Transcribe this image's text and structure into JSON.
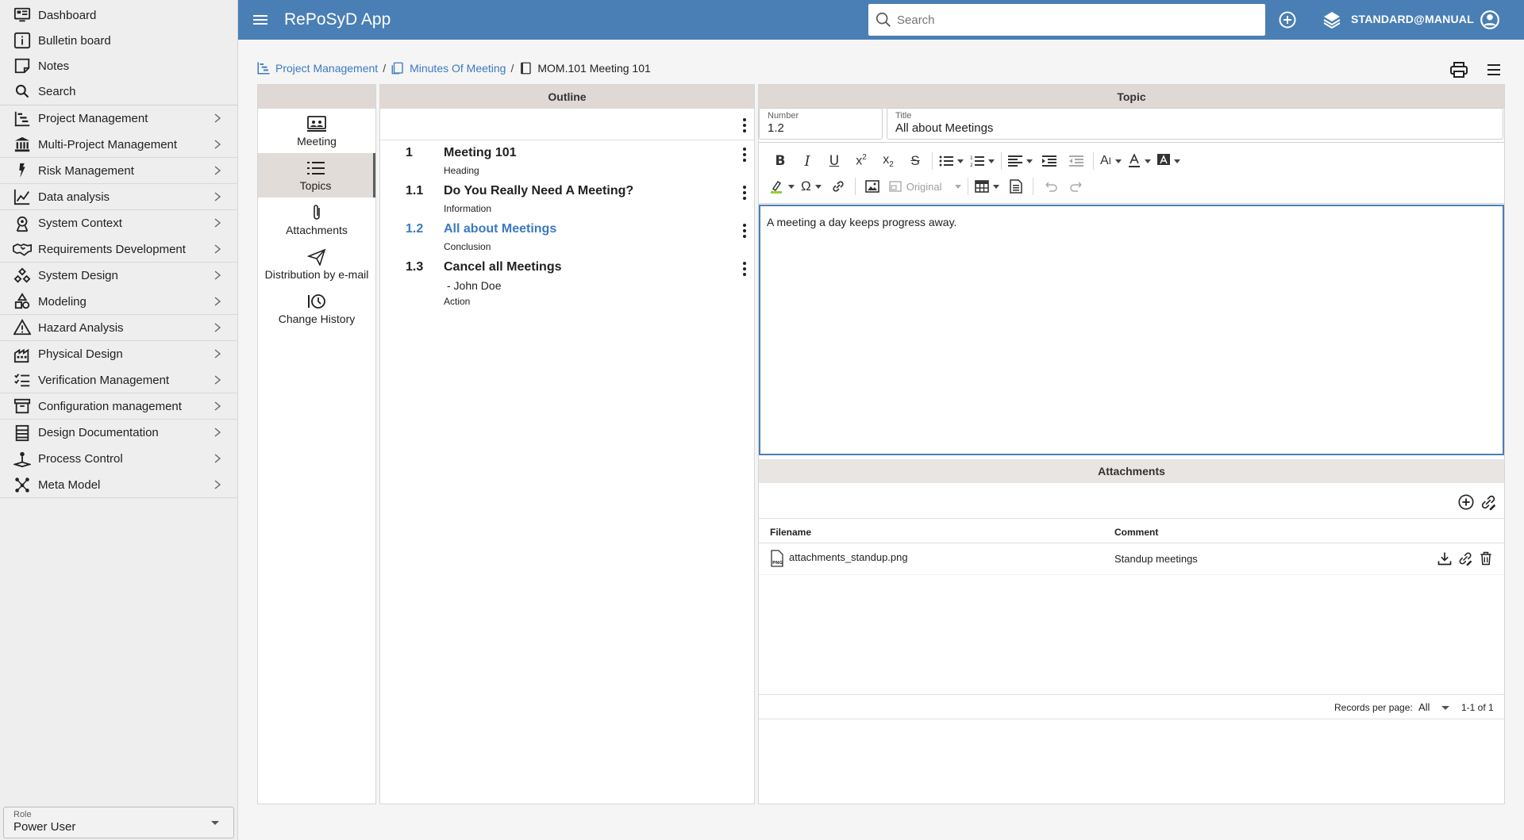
{
  "app": {
    "title": "RePoSyD App",
    "user": "STANDARD@MANUAL"
  },
  "search": {
    "placeholder": "Search"
  },
  "sidebar": {
    "top_items": [
      {
        "label": "Dashboard",
        "icon": "dashboard-icon"
      },
      {
        "label": "Bulletin board",
        "icon": "info-icon"
      },
      {
        "label": "Notes",
        "icon": "notes-icon"
      },
      {
        "label": "Search",
        "icon": "search-icon"
      }
    ],
    "modules": [
      {
        "label": "Project Management",
        "icon": "gantt-icon"
      },
      {
        "label": "Multi-Project Management",
        "icon": "bank-icon"
      },
      {
        "label": "Risk Management",
        "icon": "risk-icon"
      },
      {
        "label": "Data analysis",
        "icon": "chart-line-icon"
      },
      {
        "label": "System Context",
        "icon": "context-icon"
      },
      {
        "label": "Requirements Development",
        "icon": "handshake-icon"
      },
      {
        "label": "System Design",
        "icon": "design-icon"
      },
      {
        "label": "Modeling",
        "icon": "shapes-icon"
      },
      {
        "label": "Hazard Analysis",
        "icon": "warning-icon"
      },
      {
        "label": "Physical Design",
        "icon": "factory-icon"
      },
      {
        "label": "Verification Management",
        "icon": "checklist-icon"
      },
      {
        "label": "Configuration management",
        "icon": "archive-icon"
      },
      {
        "label": "Design Documentation",
        "icon": "document-list-icon"
      },
      {
        "label": "Process Control",
        "icon": "joystick-icon"
      },
      {
        "label": "Meta Model",
        "icon": "graph-icon"
      }
    ],
    "role": {
      "label": "Role",
      "value": "Power User"
    }
  },
  "breadcrumb": {
    "items": [
      "Project Management",
      "Minutes Of Meeting"
    ],
    "current": "MOM.101 Meeting 101",
    "separator": "/"
  },
  "nav": {
    "items": [
      {
        "label": "Meeting",
        "icon": "meeting-icon",
        "active": false
      },
      {
        "label": "Topics",
        "icon": "list-icon",
        "active": true
      },
      {
        "label": "Attachments",
        "icon": "paperclip-icon",
        "active": false
      },
      {
        "label": "Distribution by e-mail",
        "icon": "send-icon",
        "active": false
      },
      {
        "label": "Change History",
        "icon": "history-icon",
        "active": false
      }
    ]
  },
  "outline": {
    "header": "Outline",
    "items": [
      {
        "number": "1",
        "title": "Meeting 101",
        "extra": "",
        "type": "Heading",
        "active": false
      },
      {
        "number": "1.1",
        "title": "Do You Really Need A Meeting?",
        "extra": "",
        "type": "Information",
        "active": false
      },
      {
        "number": "1.2",
        "title": "All about Meetings",
        "extra": "",
        "type": "Conclusion",
        "active": true
      },
      {
        "number": "1.3",
        "title": "Cancel all Meetings",
        "extra": "- John Doe",
        "type": "Action",
        "active": false
      }
    ]
  },
  "topic": {
    "header": "Topic",
    "number_label": "Number",
    "number_value": "1.2",
    "title_label": "Title",
    "title_value": "All about Meetings",
    "image_size_option": "Original",
    "body": "A meeting a day keeps progress away."
  },
  "attachments": {
    "header": "Attachments",
    "columns": [
      "Filename",
      "Comment"
    ],
    "rows": [
      {
        "filename": "attachments_standup.png",
        "comment": "Standup meetings"
      }
    ],
    "records_label": "Records per page:",
    "records_value": "All",
    "range": "1-1 of 1"
  },
  "colors": {
    "header": "#4a7fb5",
    "link": "#3b79c2",
    "panel_head": "#e0d8d5"
  }
}
